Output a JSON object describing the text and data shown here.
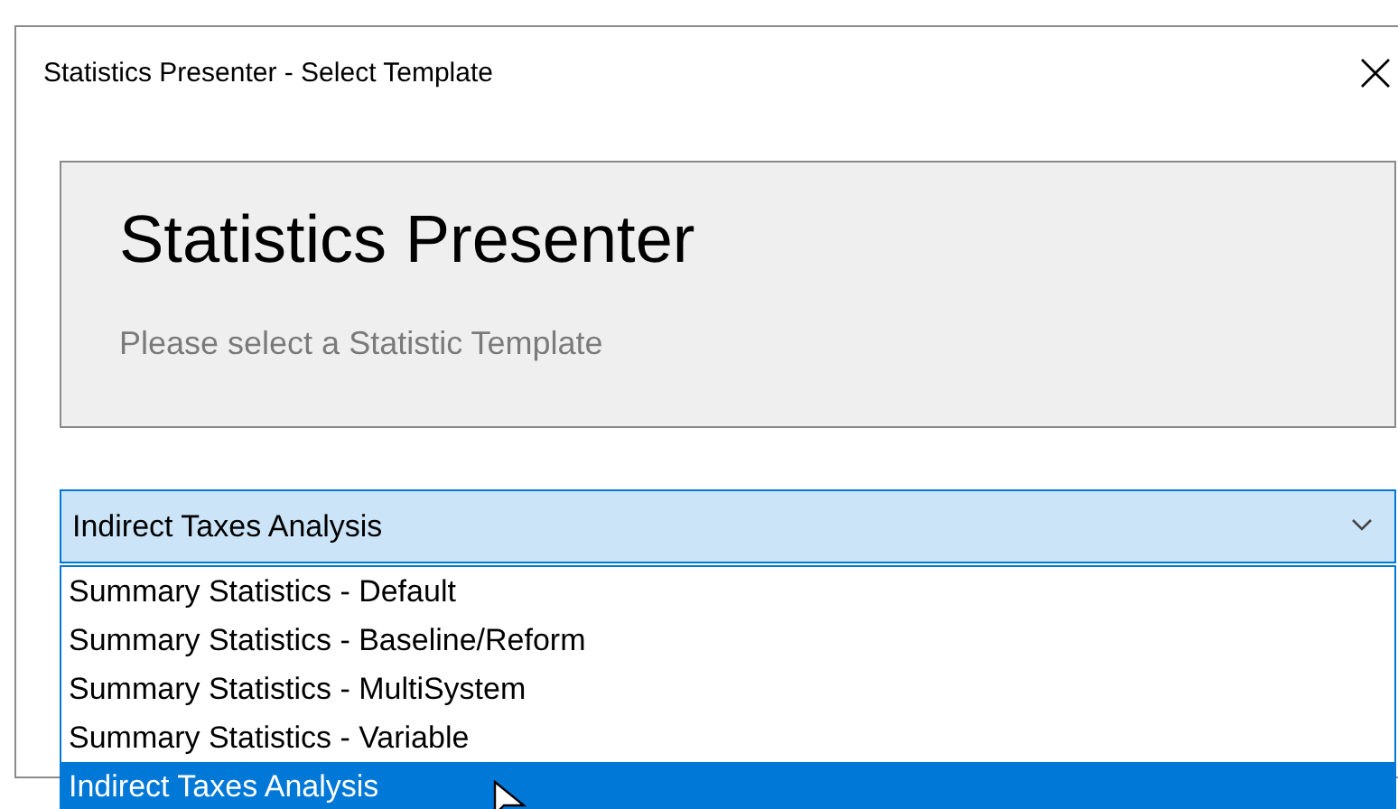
{
  "window": {
    "title": "Statistics Presenter - Select Template"
  },
  "header": {
    "title": "Statistics Presenter",
    "subtitle": "Please select a Statistic Template"
  },
  "combo": {
    "value": "Indirect Taxes Analysis",
    "expanded": true,
    "options": [
      {
        "label": "Summary Statistics - Default",
        "selected": false
      },
      {
        "label": "Summary Statistics - Baseline/Reform",
        "selected": false
      },
      {
        "label": "Summary Statistics - MultiSystem",
        "selected": false
      },
      {
        "label": "Summary Statistics - Variable",
        "selected": false
      },
      {
        "label": "Indirect Taxes Analysis",
        "selected": true
      }
    ]
  }
}
